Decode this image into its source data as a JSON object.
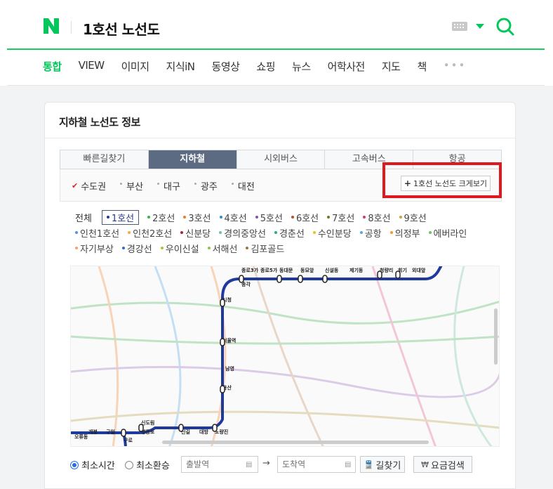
{
  "header": {
    "logo": "N",
    "query": "1호선 노선도",
    "tabs": [
      "통합",
      "VIEW",
      "이미지",
      "지식iN",
      "동영상",
      "쇼핑",
      "뉴스",
      "어학사전",
      "지도",
      "책"
    ],
    "more": "•••",
    "brand_color": "#03c75a"
  },
  "card": {
    "title": "지하철 노선도 정보",
    "segments": [
      "빠른길찾기",
      "지하철",
      "시외버스",
      "고속버스",
      "항공"
    ],
    "regions": [
      {
        "label": "수도권",
        "selected": true
      },
      {
        "label": "부산",
        "selected": false
      },
      {
        "label": "대구",
        "selected": false
      },
      {
        "label": "광주",
        "selected": false
      },
      {
        "label": "대전",
        "selected": false
      }
    ],
    "enlarge_label": "1호선 노선도 크게보기",
    "lines_label": "전체",
    "line_rows": [
      [
        {
          "label": "1호선",
          "color": "#1e3a9c",
          "selected": true
        },
        {
          "label": "2호선",
          "color": "#3cb44a"
        },
        {
          "label": "3호선",
          "color": "#f07a2b"
        },
        {
          "label": "4호선",
          "color": "#2c8fd6"
        },
        {
          "label": "5호선",
          "color": "#8b50a4"
        },
        {
          "label": "6호선",
          "color": "#b5502a"
        },
        {
          "label": "7호선",
          "color": "#6b7a1e"
        },
        {
          "label": "8호선",
          "color": "#e0336e"
        },
        {
          "label": "9호선",
          "color": "#c9a43c"
        }
      ],
      [
        {
          "label": "인천1호선",
          "color": "#5d8ed4"
        },
        {
          "label": "인천2호선",
          "color": "#f5a83a"
        },
        {
          "label": "신분당",
          "color": "#b51c39"
        },
        {
          "label": "경의중앙선",
          "color": "#6fc2a0"
        },
        {
          "label": "경춘선",
          "color": "#2ea88a"
        },
        {
          "label": "수인분당",
          "color": "#e8c21d"
        },
        {
          "label": "공항",
          "color": "#5aa6d8"
        },
        {
          "label": "의정부",
          "color": "#f39a2e"
        },
        {
          "label": "에버라인",
          "color": "#6cc26a"
        }
      ],
      [
        {
          "label": "자기부상",
          "color": "#f5a36a"
        },
        {
          "label": "경강선",
          "color": "#2b6fd0"
        },
        {
          "label": "우이신설",
          "color": "#b0c22a"
        },
        {
          "label": "서해선",
          "color": "#8cc54a"
        },
        {
          "label": "김포골드",
          "color": "#9a7a2a"
        }
      ]
    ],
    "map_stations": [
      {
        "name": "종로3가"
      },
      {
        "name": "종로5가"
      },
      {
        "name": "동대문"
      },
      {
        "name": "동묘앞"
      },
      {
        "name": "신설동"
      },
      {
        "name": "제기동"
      },
      {
        "name": "청량리"
      },
      {
        "name": "회기"
      },
      {
        "name": "외대앞"
      },
      {
        "name": "종각"
      },
      {
        "name": "시청"
      },
      {
        "name": "서울역"
      },
      {
        "name": "남영"
      },
      {
        "name": "용산"
      },
      {
        "name": "노량진"
      },
      {
        "name": "대방"
      },
      {
        "name": "신길"
      },
      {
        "name": "영등포"
      },
      {
        "name": "신도림"
      },
      {
        "name": "구로"
      },
      {
        "name": "구일"
      },
      {
        "name": "개봉"
      },
      {
        "name": "오류동"
      }
    ],
    "line1_color": "#1e3a9c",
    "route_options": [
      {
        "label": "최소시간",
        "selected": true
      },
      {
        "label": "최소환승",
        "selected": false
      }
    ],
    "from_placeholder": "출발역",
    "to_placeholder": "도착역",
    "find_button": "길찾기",
    "fare_button": "요금검색"
  }
}
